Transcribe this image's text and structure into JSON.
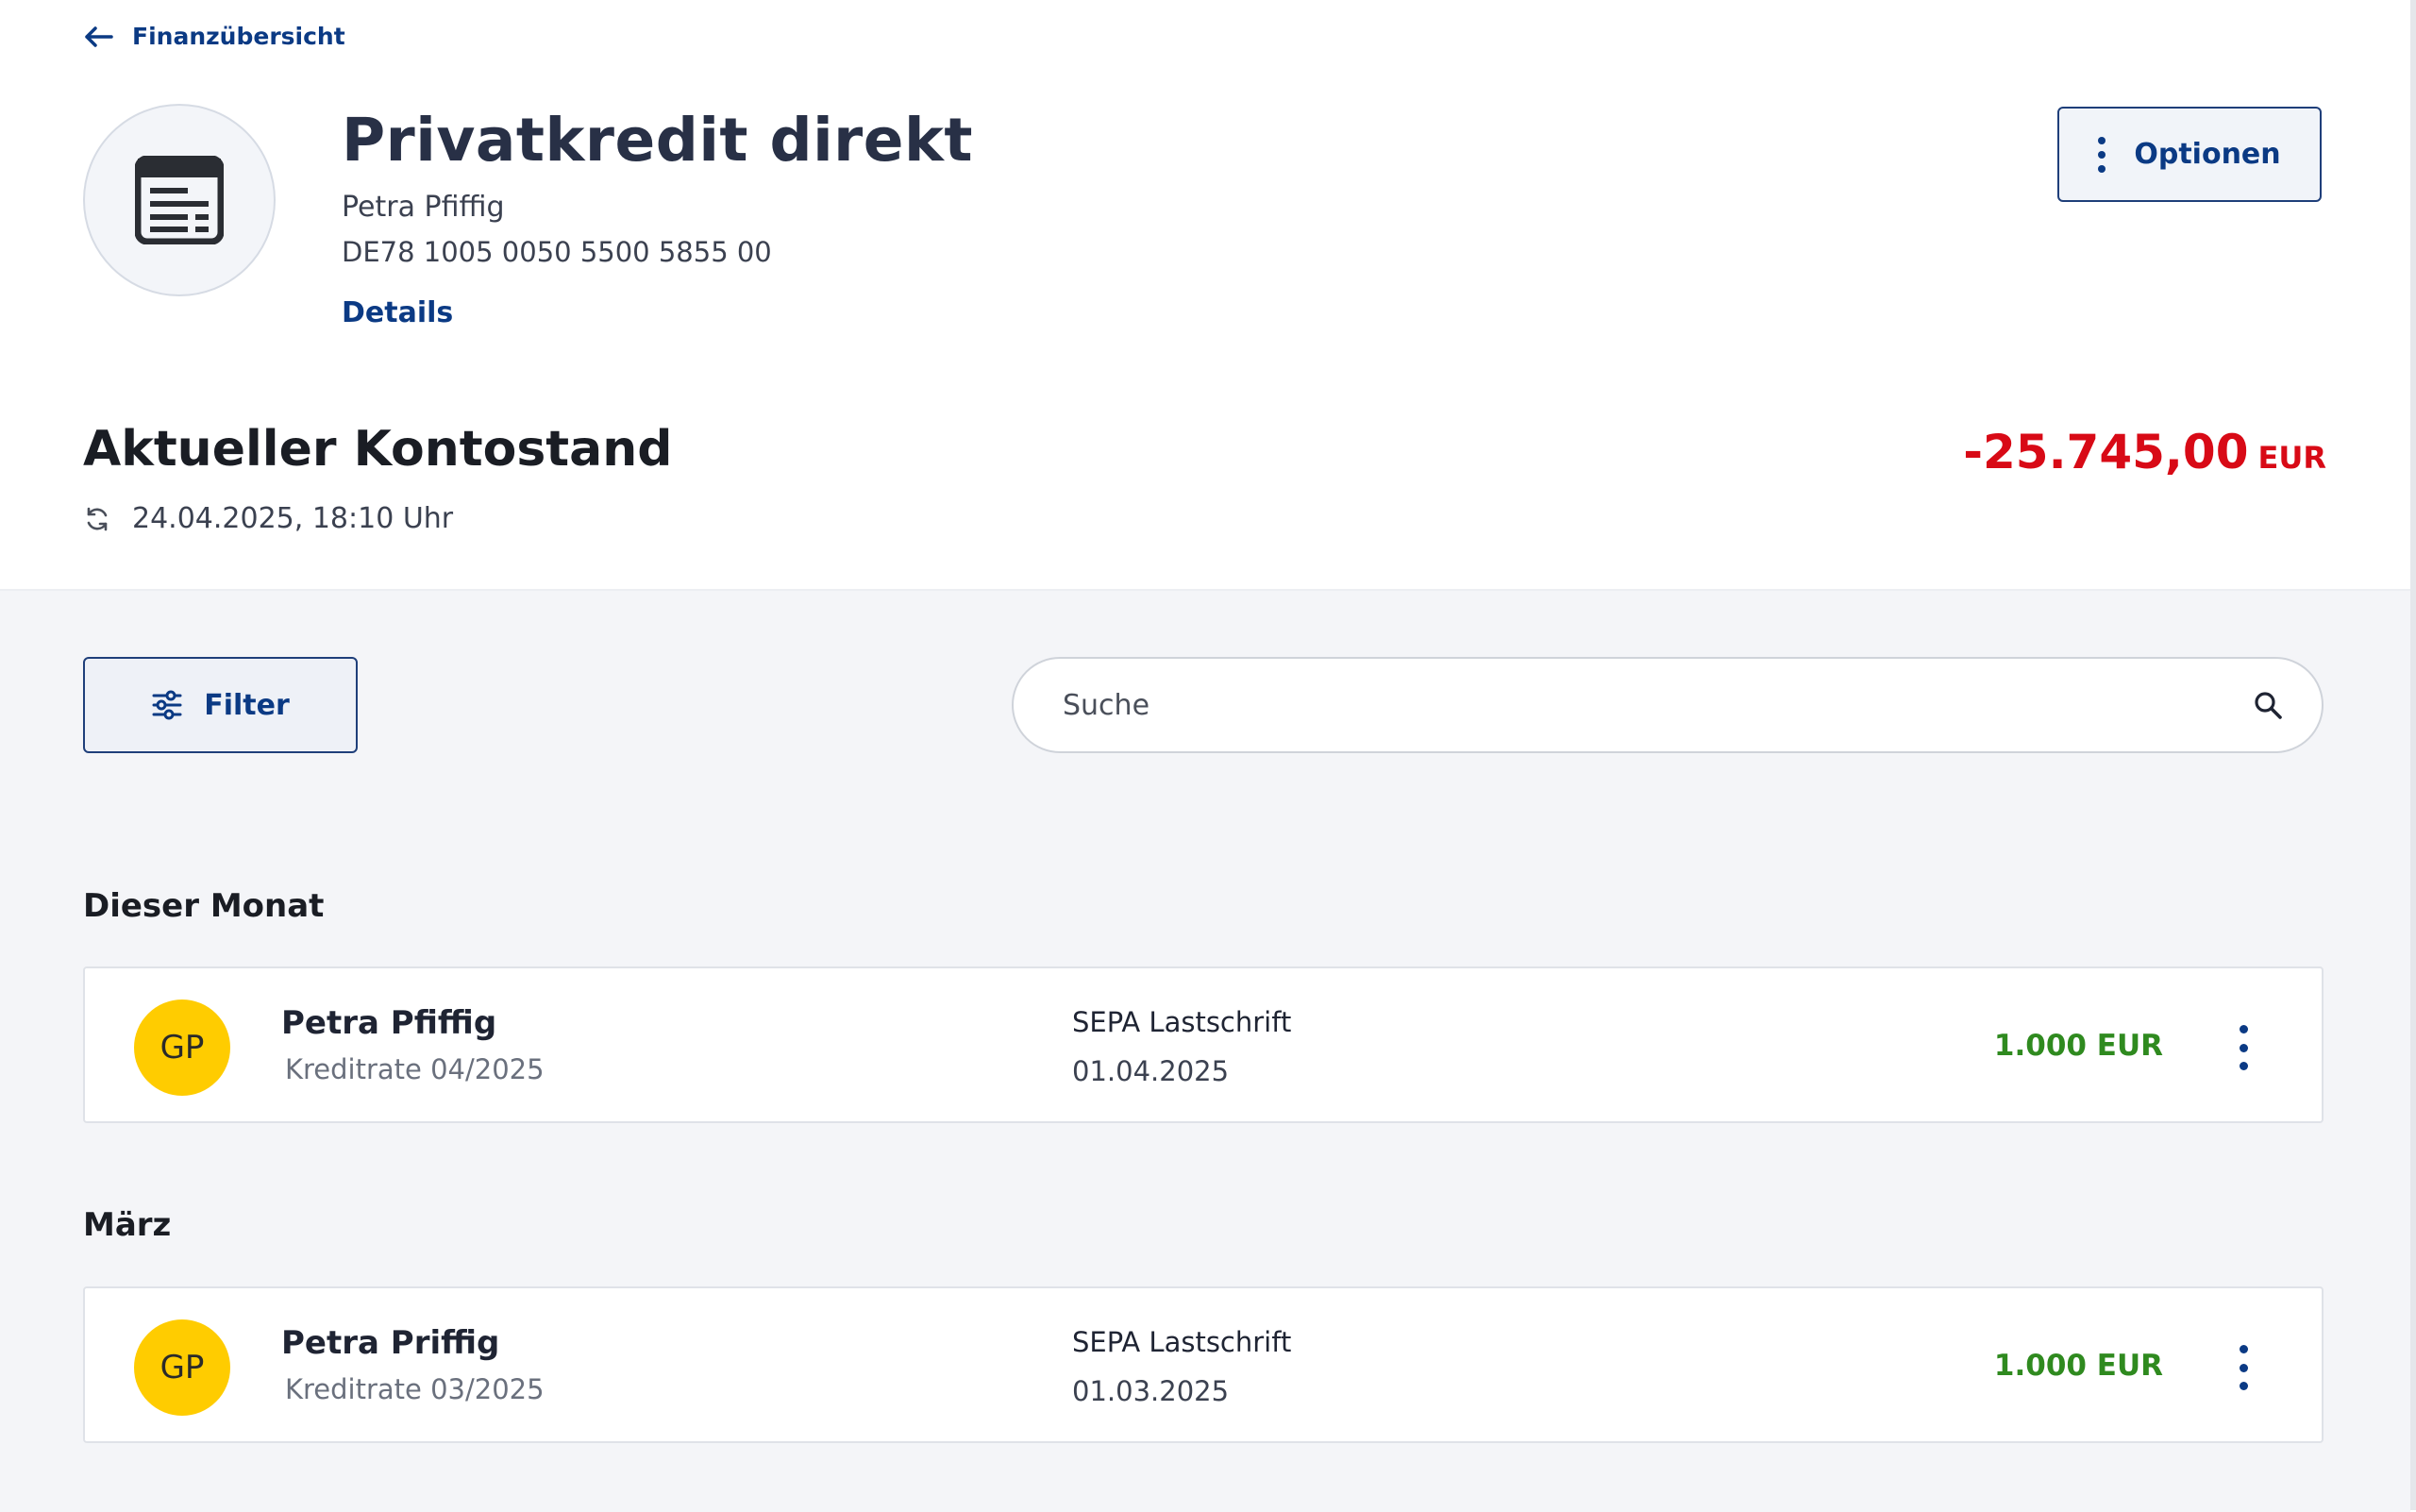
{
  "back_link": {
    "label": "Finanzübersicht",
    "icon": "arrow-left-icon"
  },
  "account": {
    "title": "Privatkredit direkt",
    "owner": "Petra Pfiffig",
    "iban": "DE78 1005 0050 5500 5855 00",
    "details_label": "Details",
    "icon": "account-document-icon"
  },
  "options_button": {
    "label": "Optionen",
    "icon": "kebab-vertical-icon"
  },
  "balance": {
    "label": "Aktueller Kontostand",
    "timestamp": "24.04.2025, 18:10 Uhr",
    "amount": "-25.745,00",
    "currency": "EUR",
    "color": "#d80a16"
  },
  "filter_button": {
    "label": "Filter",
    "icon": "sliders-icon"
  },
  "search": {
    "placeholder": "Suche",
    "value": "",
    "icon": "search-icon"
  },
  "groups": [
    {
      "heading": "Dieser Monat",
      "transactions": [
        {
          "initials": "GP",
          "name": "Petra Pfiffig",
          "purpose": "Kreditrate 04/2025",
          "type": "SEPA Lastschrift",
          "date": "01.04.2025",
          "amount": "1.000 EUR"
        }
      ]
    },
    {
      "heading": "März",
      "transactions": [
        {
          "initials": "GP",
          "name": "Petra Priffig",
          "purpose": "Kreditrate 03/2025",
          "type": "SEPA Lastschrift",
          "date": "01.03.2025",
          "amount": "1.000 EUR"
        }
      ]
    }
  ],
  "colors": {
    "primary": "#0b3a84",
    "positive": "#2f8a1f",
    "negative": "#d80a16",
    "avatar": "#ffcc00"
  }
}
